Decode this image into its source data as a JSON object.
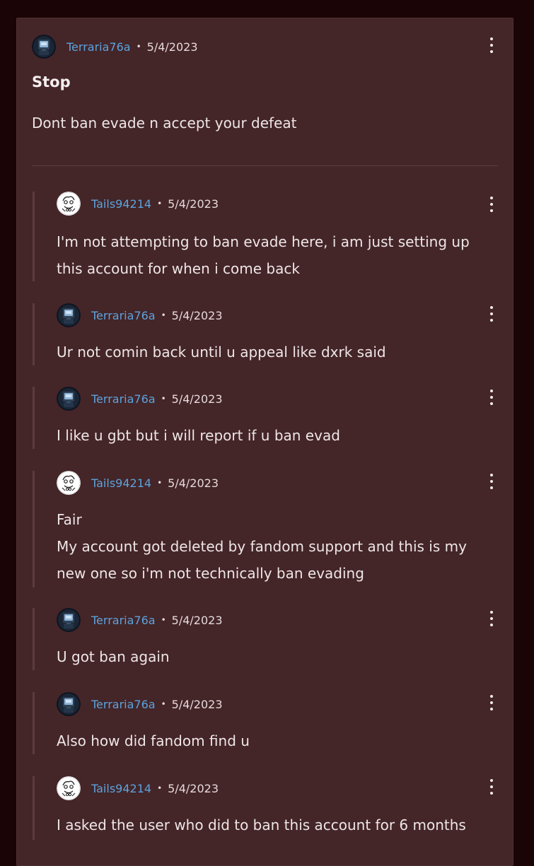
{
  "post": {
    "author": "Terraria76a",
    "separator": "•",
    "date": "5/4/2023",
    "title": "Stop",
    "body": "Dont ban evade n accept your defeat"
  },
  "replies": [
    {
      "author": "Tails94214",
      "separator": "•",
      "date": "5/4/2023",
      "lines": [
        "I'm not attempting to ban evade here, i am just setting up",
        "this account for when i come back"
      ]
    },
    {
      "author": "Terraria76a",
      "separator": "•",
      "date": "5/4/2023",
      "lines": [
        "Ur not comin back until u appeal like dxrk said"
      ]
    },
    {
      "author": "Terraria76a",
      "separator": "•",
      "date": "5/4/2023",
      "lines": [
        "I like u gbt but i will report if u ban evad"
      ]
    },
    {
      "author": "Tails94214",
      "separator": "•",
      "date": "5/4/2023",
      "lines": [
        "Fair",
        "My account got deleted by fandom support and this is my",
        "new one so i'm not technically ban evading"
      ]
    },
    {
      "author": "Terraria76a",
      "separator": "•",
      "date": "5/4/2023",
      "lines": [
        "U got ban again"
      ]
    },
    {
      "author": "Terraria76a",
      "separator": "•",
      "date": "5/4/2023",
      "lines": [
        "Also how did fandom find u"
      ]
    },
    {
      "author": "Tails94214",
      "separator": "•",
      "date": "5/4/2023",
      "lines": [
        "I asked the user who did to ban this account for 6 months"
      ]
    }
  ],
  "icons": {
    "more": "more-options-icon",
    "avatar_terraria": "robot-avatar-icon",
    "avatar_tails": "sketch-avatar-icon"
  },
  "colors": {
    "background": "#1b0405",
    "card": "#442528",
    "link": "#5ba3dd",
    "text": "#eee6e6"
  }
}
